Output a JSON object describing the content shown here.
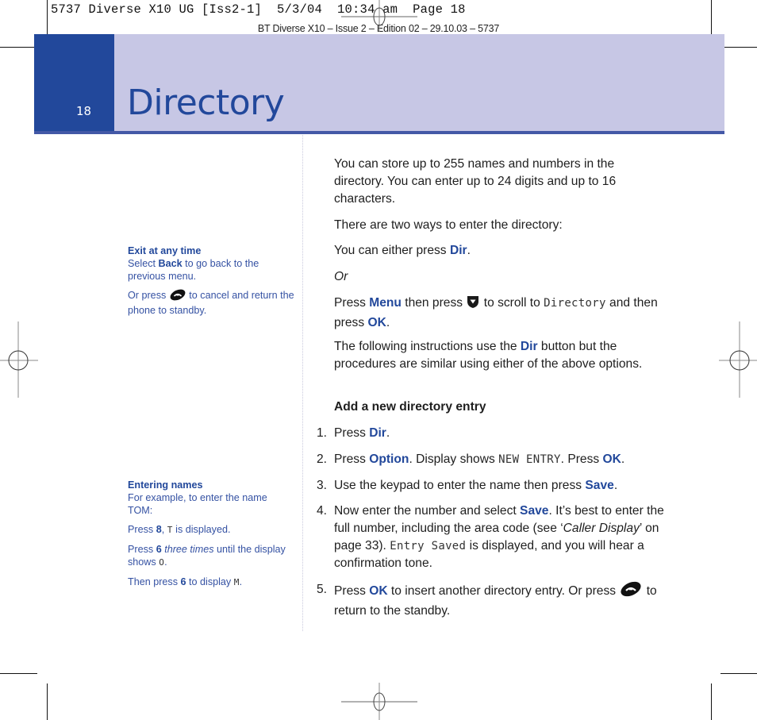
{
  "slug": "5737 Diverse X10 UG [Iss2-1]  5/3/04  10:34 am  Page 18",
  "edition": "BT Diverse X10 – Issue 2 – Edition 02 – 29.10.03 – 5737",
  "header": {
    "page_number": "18",
    "title": "Directory"
  },
  "colors": {
    "brand_dark": "#22489b",
    "band_light": "#c7c7e5",
    "rule": "#4358a6"
  },
  "sidebar": {
    "exit": {
      "heading": "Exit at any time",
      "line1_pre": "Select ",
      "line1_kw": "Back",
      "line1_post": " to go back to the previous menu.",
      "line2_pre": "Or press ",
      "line2_icon": "end-call-icon",
      "line2_post": " to cancel and return the phone to standby."
    },
    "entering": {
      "heading": "Entering names",
      "intro": "For example, to enter the name TOM:",
      "p1_pre": "Press ",
      "p1_kw": "8",
      "p1_mid": ", ",
      "p1_lcd": "T",
      "p1_post": " is displayed.",
      "p2_pre": "Press ",
      "p2_kw": "6",
      "p2_em": " three times",
      "p2_post": " until the display shows ",
      "p2_lcd": "O",
      "p2_end": ".",
      "p3_pre": "Then press ",
      "p3_kw": "6",
      "p3_post": " to display ",
      "p3_lcd": "M",
      "p3_end": "."
    }
  },
  "main": {
    "intro": "You can store up to 255 names and numbers in the directory. You can enter up to 24 digits and up to 16 characters.",
    "two_ways": "There are two ways to enter the directory:",
    "either_pre": "You can either press ",
    "either_kw": "Dir",
    "either_post": ".",
    "or": "Or",
    "menu_pre": "Press ",
    "menu_kw": "Menu",
    "menu_mid": " then press ",
    "menu_icon": "scroll-down-icon",
    "menu_mid2": " to scroll to ",
    "menu_lcd": "Directory",
    "menu_mid3": " and then press ",
    "menu_kw2": "OK",
    "menu_post": ".",
    "following_pre": "The following instructions use the ",
    "following_kw": "Dir",
    "following_post": " button but the procedures are similar using either of the above options.",
    "section_heading": "Add a new directory entry",
    "steps": [
      {
        "num": "1.",
        "pre": "Press ",
        "kw": "Dir",
        "post": "."
      },
      {
        "num": "2.",
        "pre": "Press ",
        "kw": "Option",
        "mid": ". Display shows ",
        "lcd": "NEW ENTRY",
        "mid2": ". Press ",
        "kw2": "OK",
        "post": "."
      },
      {
        "num": "3.",
        "pre": "Use the keypad to enter the name then press ",
        "kw": "Save",
        "post": "."
      },
      {
        "num": "4.",
        "pre": "Now enter the number and select ",
        "kw": "Save",
        "mid": ". It’s best to enter the full number, including the area code (see ‘",
        "em": "Caller Display",
        "mid2": "’ on page 33). ",
        "lcd": "Entry Saved",
        "post": " is displayed, and you will hear a confirmation tone."
      },
      {
        "num": "5.",
        "pre": "Press ",
        "kw": "OK",
        "mid": " to insert another directory entry. Or press ",
        "icon": "end-call-icon",
        "post": " to return to the standby."
      }
    ]
  }
}
